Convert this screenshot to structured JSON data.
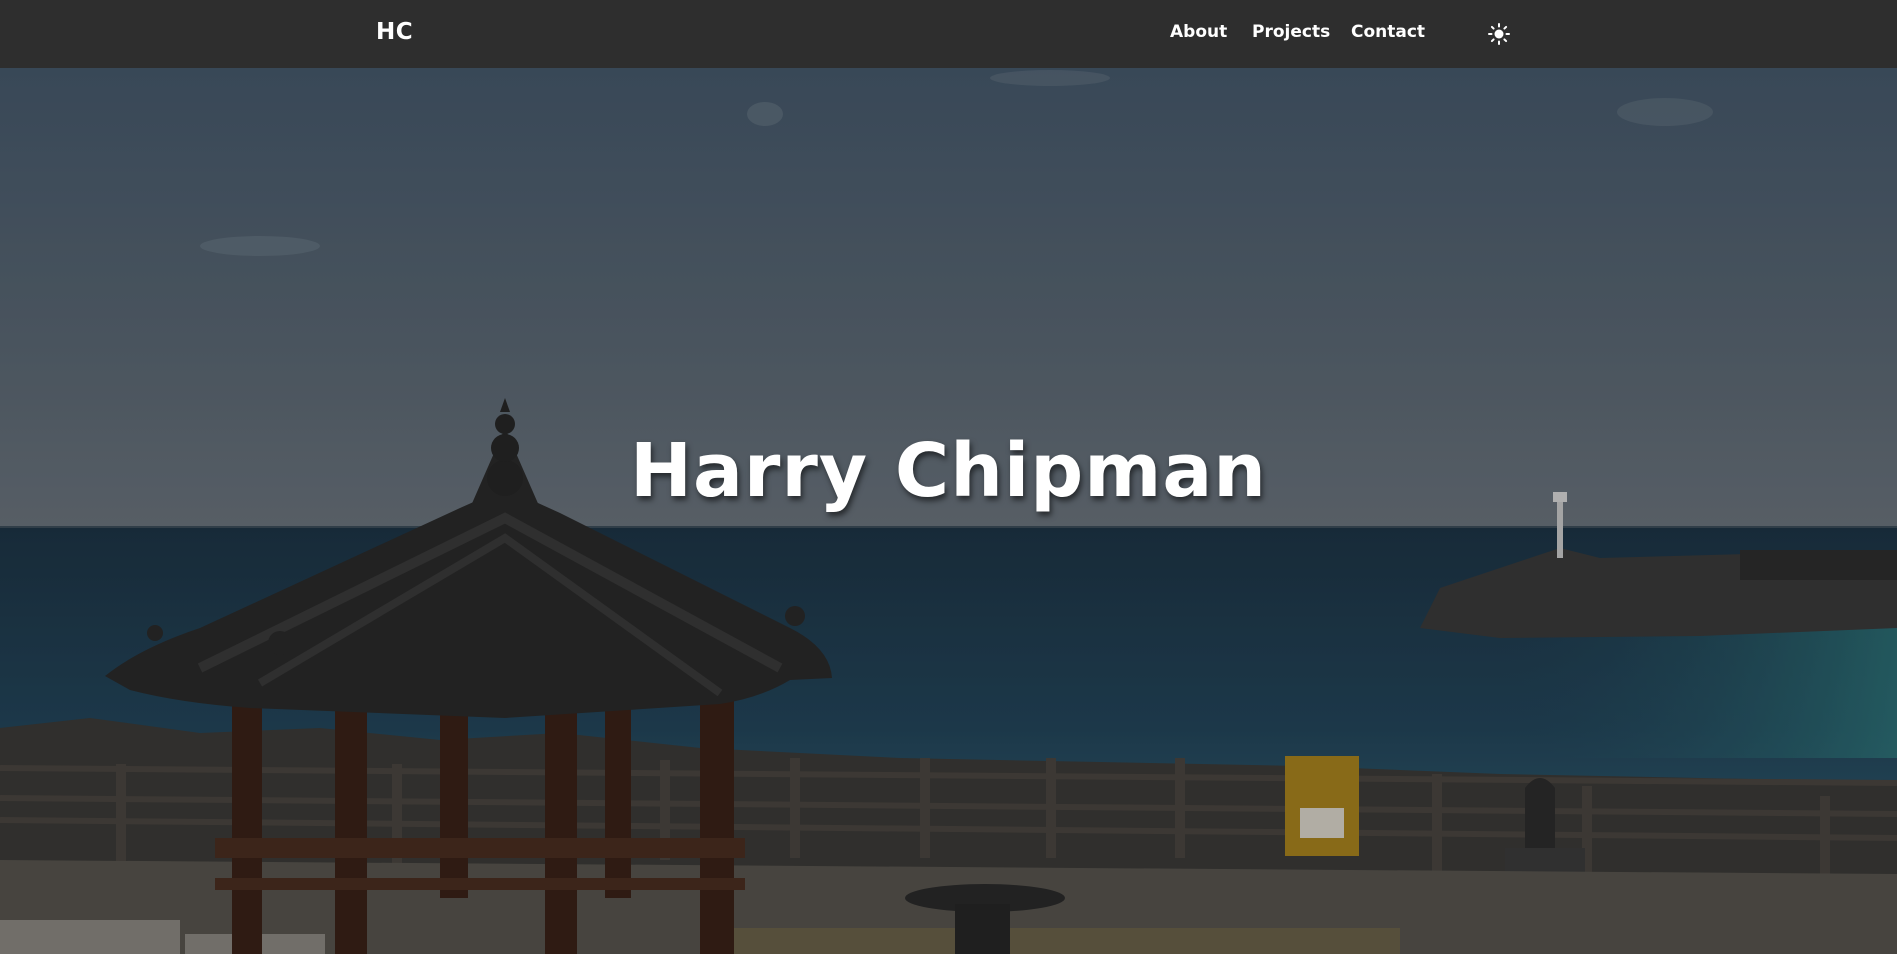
{
  "nav": {
    "logo": "HC",
    "links": [
      {
        "label": "About"
      },
      {
        "label": "Projects"
      },
      {
        "label": "Contact"
      }
    ],
    "theme_toggle_icon": "sun-icon"
  },
  "hero": {
    "title": "Harry Chipman",
    "background_image": "coastal-pavilion-photo"
  },
  "colors": {
    "navbar": "#2e2e2e",
    "text": "#ffffff",
    "sky": "#4a5d70",
    "sea": "#1f3a4e"
  }
}
